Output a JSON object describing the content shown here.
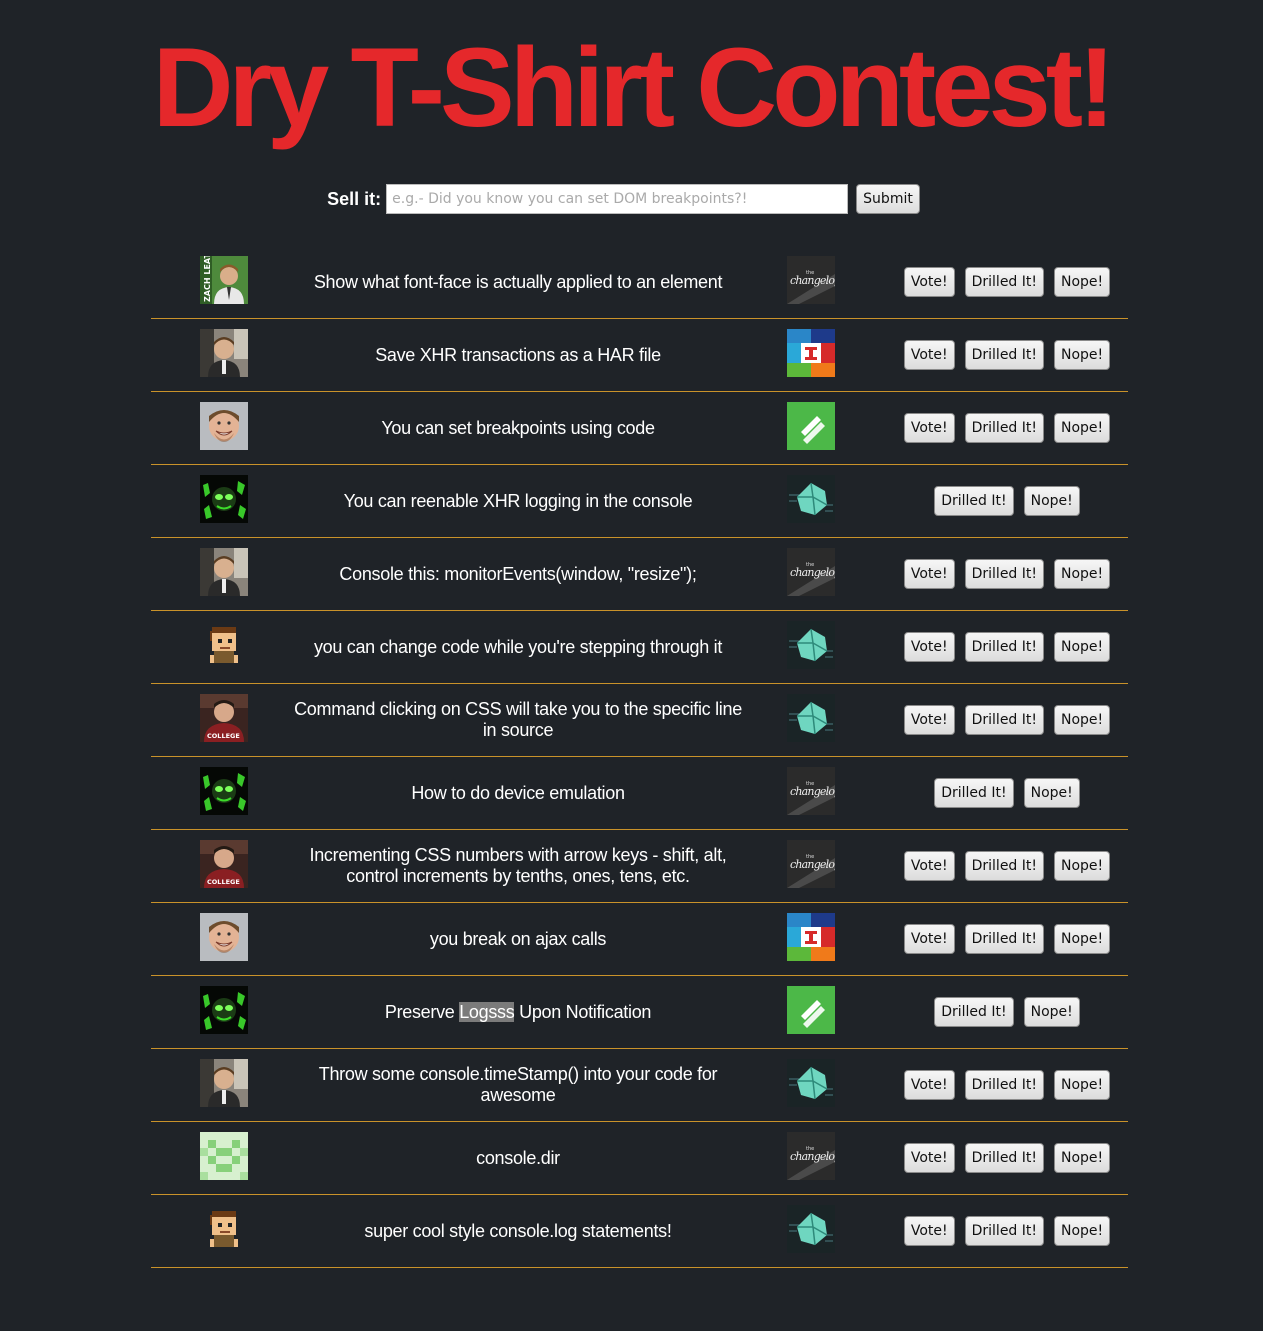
{
  "page": {
    "title": "Dry T-Shirt Contest!"
  },
  "form": {
    "label": "Sell it:",
    "placeholder": "e.g.- Did you know you can set DOM breakpoints?!",
    "submit_label": "Submit"
  },
  "buttons": {
    "vote": "Vote!",
    "drilled": "Drilled It!",
    "nope": "Nope!"
  },
  "avatar_labels": {
    "zach": "ZACH LEAT",
    "college": "COLLEGE"
  },
  "brand_labels": {
    "changelog_small": "the",
    "changelog": "changelog"
  },
  "colors": {
    "title": "#e5282b",
    "background": "#1f2328",
    "divider": "#c9922a"
  },
  "tips": [
    {
      "avatar": "zach-leat",
      "text": "Show what font-face is actually applied to an element",
      "brand": "changelog",
      "can_vote": true
    },
    {
      "avatar": "webcam-guy",
      "text": "Save XHR transactions as a HAR file",
      "brand": "blocks-logo",
      "can_vote": true
    },
    {
      "avatar": "smiling-man",
      "text": "You can set breakpoints using code",
      "brand": "green-logo",
      "can_vote": true
    },
    {
      "avatar": "green-hacker",
      "text": "You can reenable XHR logging in the console",
      "brand": "crystal-logo",
      "can_vote": false
    },
    {
      "avatar": "webcam-guy",
      "text": "Console this: monitorEvents(window, \"resize\");",
      "brand": "changelog",
      "can_vote": true
    },
    {
      "avatar": "pixel-character",
      "text": "you can change code while you're stepping through it",
      "brand": "crystal-logo",
      "can_vote": true
    },
    {
      "avatar": "college-guy",
      "text": "Command clicking on CSS will take you to the specific line in source",
      "brand": "crystal-logo",
      "can_vote": true
    },
    {
      "avatar": "green-hacker",
      "text": "How to do device emulation",
      "brand": "changelog",
      "can_vote": false
    },
    {
      "avatar": "college-guy",
      "text": "Incrementing CSS numbers with arrow keys - shift, alt, control increments by tenths, ones, tens, etc.",
      "brand": "changelog",
      "can_vote": true
    },
    {
      "avatar": "smiling-man",
      "text": "you break on ajax calls",
      "brand": "blocks-logo",
      "can_vote": true
    },
    {
      "avatar": "green-hacker",
      "text_before": "Preserve ",
      "text_highlight": "Logsss",
      "text_after": " Upon Notification",
      "brand": "green-logo",
      "can_vote": false
    },
    {
      "avatar": "webcam-guy",
      "text": "Throw some console.timeStamp() into your code for awesome",
      "brand": "crystal-logo",
      "can_vote": true
    },
    {
      "avatar": "green-pixel-pattern",
      "text": "console.dir",
      "brand": "changelog",
      "can_vote": true
    },
    {
      "avatar": "pixel-character",
      "text": "super cool style console.log statements!",
      "brand": "crystal-logo",
      "can_vote": true
    }
  ]
}
